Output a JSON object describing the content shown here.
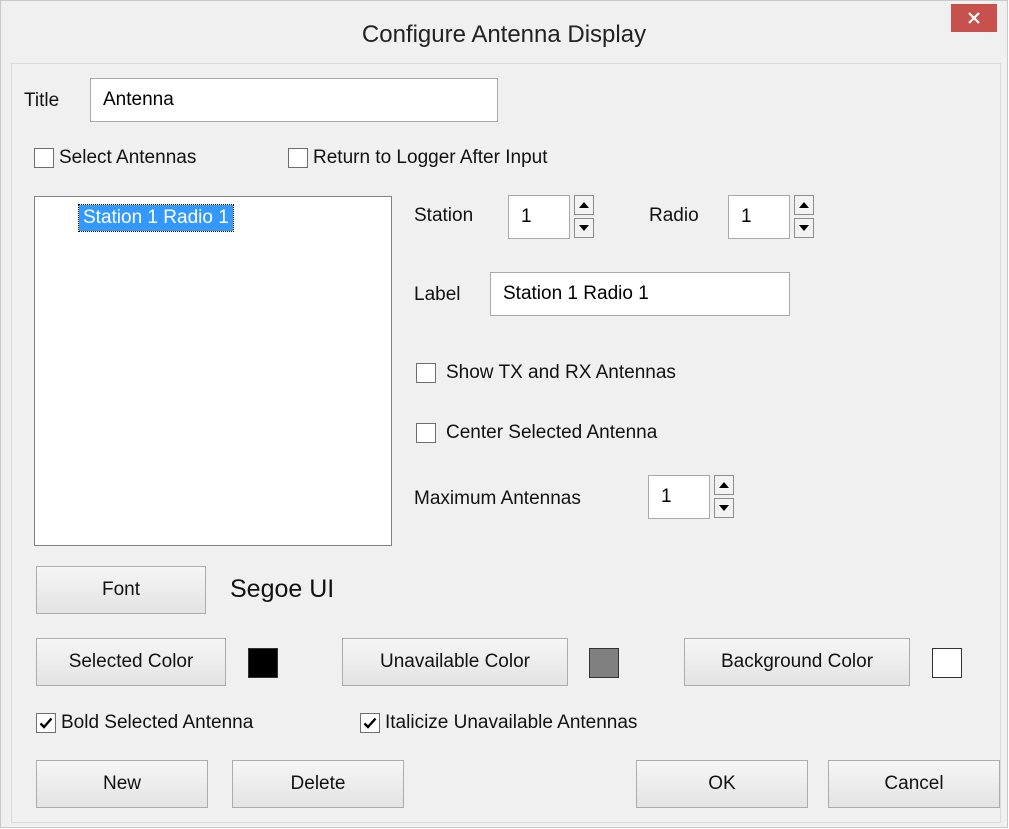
{
  "window": {
    "title": "Configure Antenna Display",
    "close_glyph": "✕"
  },
  "title_field": {
    "label": "Title",
    "value": "Antenna"
  },
  "options": {
    "select_antennas": {
      "label": "Select Antennas",
      "checked": false
    },
    "return_to_logger": {
      "label": "Return to Logger After Input",
      "checked": false
    }
  },
  "antenna_list": {
    "items": [
      "Station 1 Radio 1"
    ],
    "selected_index": 0
  },
  "station": {
    "label": "Station",
    "value": "1"
  },
  "radio": {
    "label": "Radio",
    "value": "1"
  },
  "label_field": {
    "label": "Label",
    "value": "Station 1 Radio 1"
  },
  "show_tx_rx": {
    "label": "Show TX and RX Antennas",
    "checked": false
  },
  "center_selected": {
    "label": "Center Selected Antenna",
    "checked": false
  },
  "max_antennas": {
    "label": "Maximum Antennas",
    "value": "1"
  },
  "font": {
    "button_label": "Font",
    "current": "Segoe UI"
  },
  "colors": {
    "selected": {
      "button_label": "Selected Color",
      "swatch": "#000000"
    },
    "unavailable": {
      "button_label": "Unavailable Color",
      "swatch": "#808080"
    },
    "background": {
      "button_label": "Background Color",
      "swatch": "#ffffff"
    }
  },
  "bold_selected": {
    "label": "Bold Selected Antenna",
    "checked": true
  },
  "italicize_unavailable": {
    "label": "Italicize Unavailable Antennas",
    "checked": true
  },
  "buttons": {
    "new": "New",
    "delete": "Delete",
    "ok": "OK",
    "cancel": "Cancel"
  },
  "icons": {
    "check": "check-icon",
    "up": "arrow-up-icon",
    "down": "arrow-down-icon",
    "close": "close-icon"
  },
  "accent": {
    "selection": "#3399ff",
    "close_button": "#c7514d"
  }
}
